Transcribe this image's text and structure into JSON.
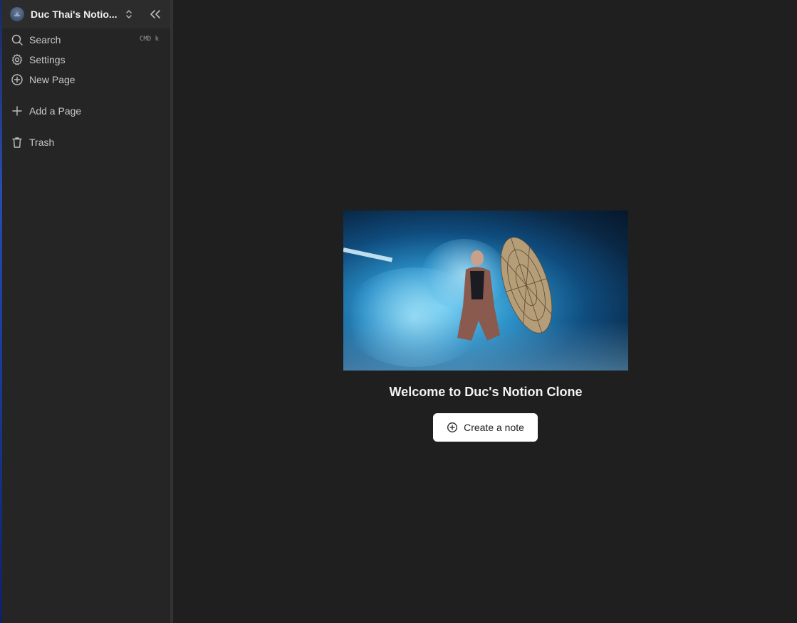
{
  "workspace": {
    "name": "Duc Thai's Notio...",
    "avatar_icon": "workspace-avatar-icon",
    "switch_icon": "chevrons-up-down-icon",
    "collapse_icon": "chevrons-left-icon"
  },
  "sidebar": {
    "items": [
      {
        "label": "Search",
        "icon": "search-icon",
        "shortcut": "CMD k"
      },
      {
        "label": "Settings",
        "icon": "gear-icon"
      },
      {
        "label": "New Page",
        "icon": "plus-circle-icon"
      },
      {
        "label": "Add a Page",
        "icon": "plus-icon"
      },
      {
        "label": "Trash",
        "icon": "trash-icon"
      }
    ]
  },
  "main": {
    "welcome_text": "Welcome to Duc's Notion Clone",
    "create_button_label": "Create a note",
    "create_button_icon": "plus-circle-icon"
  },
  "colors": {
    "sidebar_bg": "#252525",
    "main_bg": "#1f1f1f",
    "button_bg": "#ffffff"
  }
}
